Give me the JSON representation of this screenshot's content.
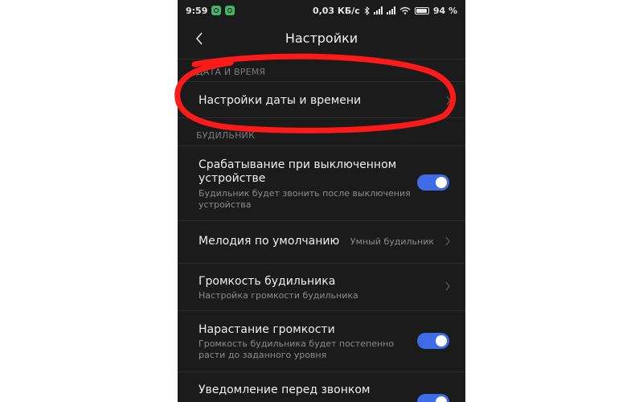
{
  "status_bar": {
    "time": "9:59",
    "network_speed": "0,03 КБ/с",
    "battery": "94 %",
    "battery_level": 0.94
  },
  "header": {
    "title": "Настройки"
  },
  "sections": {
    "date_time": {
      "header": "ДАТА И ВРЕМЯ",
      "item_title": "Настройки даты и времени"
    },
    "alarm": {
      "header": "БУДИЛЬНИК",
      "off_device": {
        "title_line1": "Срабатывание при выключенном",
        "title_line2": "устройстве",
        "sub_line1": "Будильник будет звонить после выключения",
        "sub_line2": "устройства",
        "enabled": true
      },
      "default_melody": {
        "title": "Мелодия по умолчанию",
        "value": "Умный будильник"
      },
      "alarm_volume": {
        "title": "Громкость будильника",
        "sub": "Настройка громкости будильника"
      },
      "volume_rise": {
        "title": "Нарастание громкости",
        "sub_line1": "Громкость будильника будет постепенно",
        "sub_line2": "расти до заданного уровня",
        "enabled": true
      },
      "pre_alarm_notice": {
        "title": "Уведомление перед звонком",
        "enabled": true
      }
    }
  },
  "colors": {
    "background": "#1b1b1b",
    "toggle_on": "#3d6ce6",
    "highlight": "#ff1a1a"
  }
}
